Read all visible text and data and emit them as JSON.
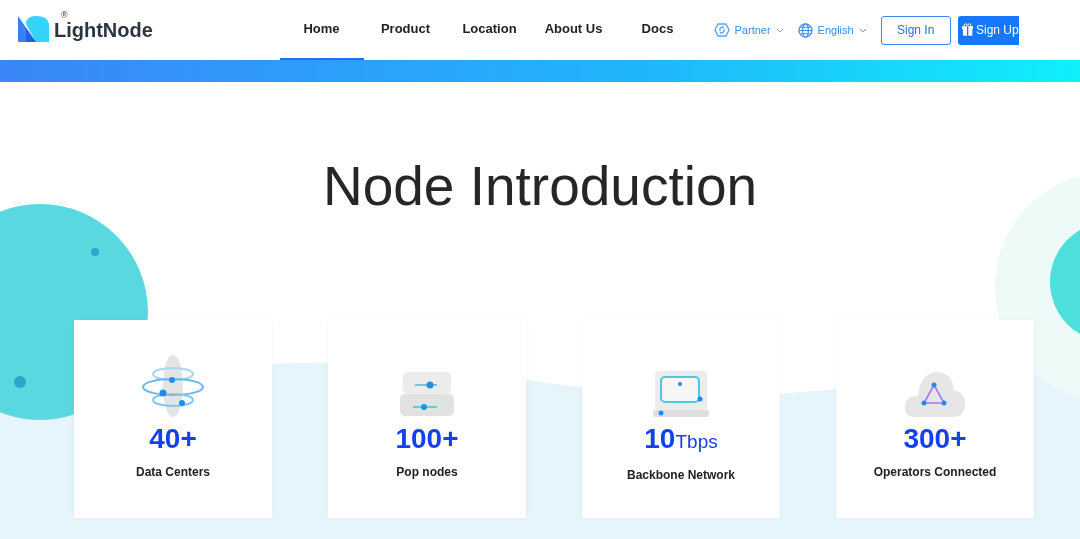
{
  "brand": {
    "name": "LightNode",
    "mark": "®"
  },
  "nav": [
    {
      "label": "Home",
      "selected": true
    },
    {
      "label": "Product",
      "selected": false
    },
    {
      "label": "Location",
      "selected": false
    },
    {
      "label": "About Us",
      "selected": false
    },
    {
      "label": "Docs",
      "selected": false
    }
  ],
  "menus": [
    {
      "label": "Partner",
      "kind": "partner"
    },
    {
      "label": "English",
      "kind": "language"
    }
  ],
  "sign_in": "Sign In",
  "sign_up": "Sign Up",
  "title": "Node Introduction",
  "stats": [
    {
      "kind": "globe",
      "value": "40+",
      "label": "Data Centers"
    },
    {
      "kind": "server",
      "value": "100+",
      "label": "Pop nodes"
    },
    {
      "kind": "monitor",
      "value": "10",
      "unit": "Tbps",
      "label": "Backbone Network"
    },
    {
      "kind": "cloud",
      "value": "300+",
      "label": "Operators Connected"
    }
  ]
}
